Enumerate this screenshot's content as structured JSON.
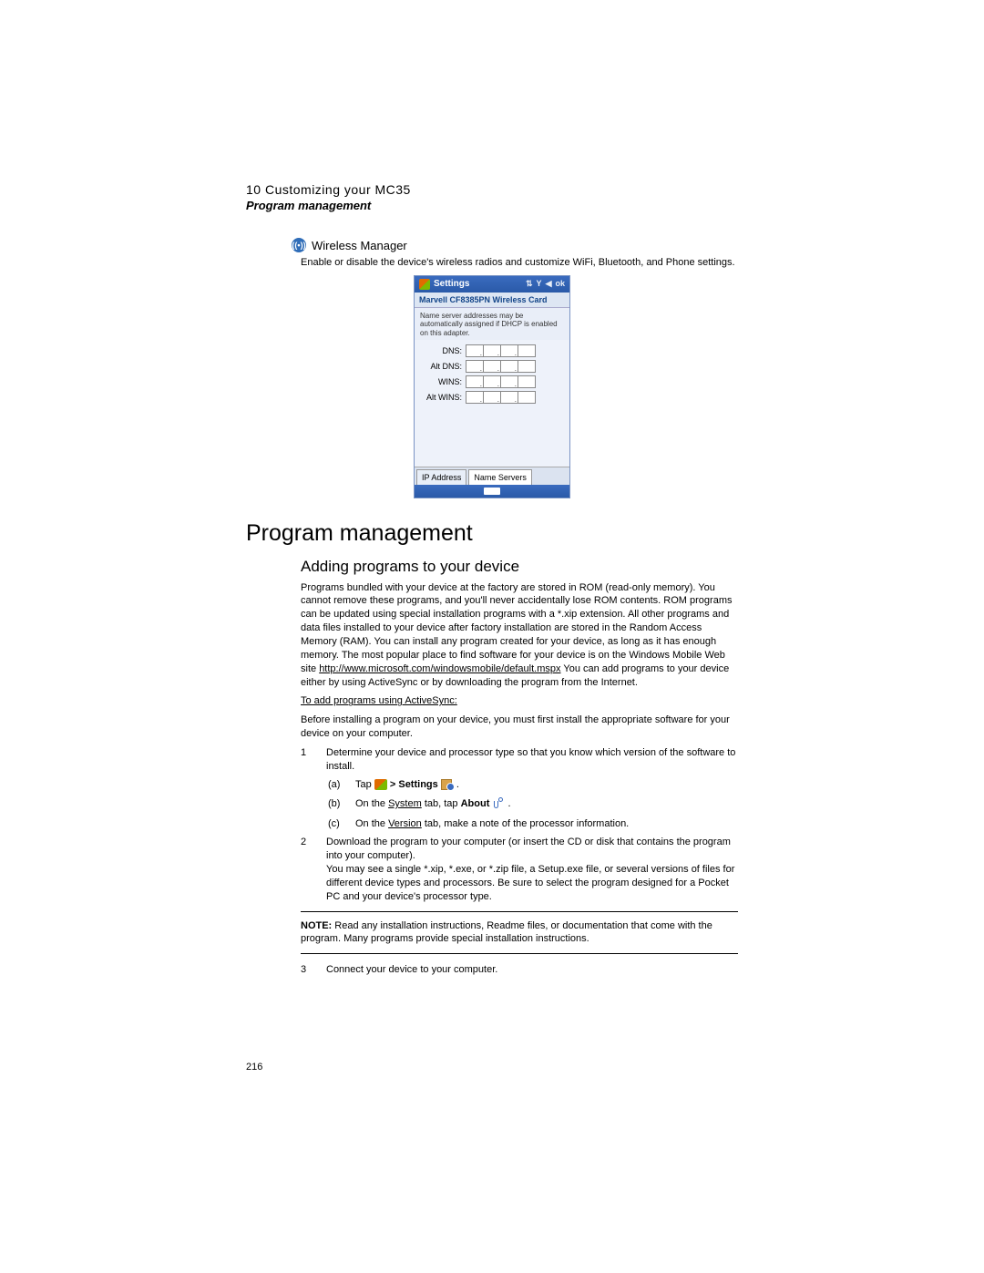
{
  "header": {
    "chapter": "10 Customizing your MC35",
    "section": "Program management"
  },
  "wireless": {
    "title": "Wireless Manager",
    "desc": "Enable or disable the device's wireless radios and customize WiFi, Bluetooth, and Phone settings."
  },
  "screenshot": {
    "title": "Settings",
    "card_title": "Marvell CF8385PN Wireless Card",
    "hint": "Name server addresses may be automatically assigned if DHCP is enabled on this adapter.",
    "rows": [
      "DNS:",
      "Alt DNS:",
      "WINS:",
      "Alt WINS:"
    ],
    "tabs": {
      "ip": "IP Address",
      "ns": "Name Servers"
    }
  },
  "section_heading": "Program management",
  "subsection_heading": "Adding programs to your device",
  "intro_para": "Programs bundled with your device at the factory are stored in ROM (read-only memory). You cannot remove these programs, and you'll never accidentally lose ROM contents. ROM programs can be updated using special installation programs with a *.xip extension. All other programs and data files installed to your device after factory installation are stored in the Random Access Memory (RAM). You can install any program created for your device, as long as it has enough memory. The most popular place to find software for your device is on the Windows Mobile Web site ",
  "intro_link": "http://www.microsoft.com/windowsmobile/default.mspx",
  "intro_tail": " You can add programs to your device either by using ActiveSync or by downloading the program from the Internet.",
  "as_heading": "To add programs using ActiveSync:",
  "as_intro": "Before installing a program on your device, you must first install the appropriate software for your device on your computer.",
  "step1": "Determine your device and processor type so that you know which version of the software to install.",
  "step1a_tap": "Tap",
  "step1a_settings": "  >  Settings",
  "step1b_pre": "On the ",
  "step1b_system": "System",
  "step1b_mid": " tab, tap ",
  "step1b_about": "About",
  "step1c_pre": "On the ",
  "step1c_version": "Version",
  "step1c_tail": " tab, make a note of the processor information.",
  "step2": "Download the program to your computer (or insert the CD or disk that contains the program into your computer).",
  "step2_para": "You may see a single *.xip, *.exe, or *.zip file, a Setup.exe file, or several versions of files for different device types and processors. Be sure to select the program designed for a Pocket PC and your device's processor type.",
  "note_label": "NOTE:",
  "note_text": "  Read any installation instructions, Readme files, or documentation that come with the program. Many programs provide special installation instructions.",
  "step3": "Connect your device to your computer.",
  "markers": {
    "one": "1",
    "two": "2",
    "three": "3",
    "a": "(a)",
    "b": "(b)",
    "c": "(c)",
    "period": " ."
  },
  "page_number": "216"
}
